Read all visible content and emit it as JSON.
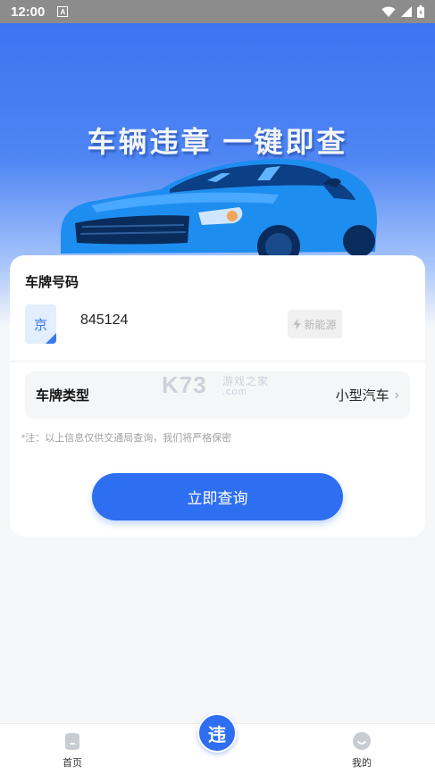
{
  "status_bar": {
    "time": "12:00",
    "notification_glyph": "A"
  },
  "hero": {
    "title": "车辆违章 一键即查"
  },
  "form": {
    "plate_label": "车牌号码",
    "province": "京",
    "plate_number": "845124",
    "new_energy_label": "新能源",
    "plate_type_label": "车牌类型",
    "plate_type_value": "小型汽车",
    "note": "*注：以上信息仅供交通局查询，我们将严格保密",
    "query_button": "立即查询"
  },
  "watermark": {
    "brand": "K73",
    "cn": "游戏之家",
    "domain": ".com"
  },
  "bottom_nav": {
    "home_label": "首页",
    "center_glyph": "违",
    "mine_label": "我的"
  },
  "colors": {
    "primary": "#2e6ef0",
    "hero_top": "#3b74f0",
    "car": "#1e8df0"
  }
}
